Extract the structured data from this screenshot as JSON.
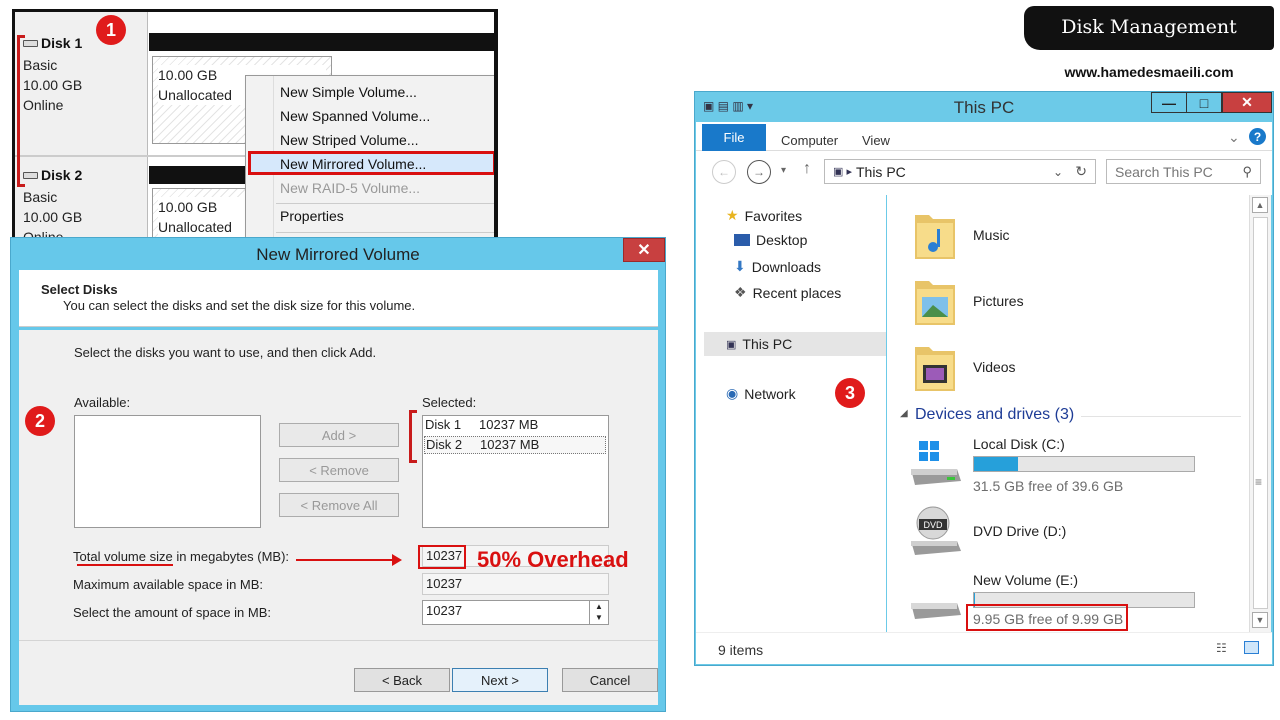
{
  "banner": {
    "title": "Disk Management",
    "url": "www.hamedesmaeili.com"
  },
  "badges": {
    "one": "1",
    "two": "2",
    "three": "3"
  },
  "disk_mgmt": {
    "disks": [
      {
        "name": "Disk 1",
        "type": "Basic",
        "size": "10.00 GB",
        "status": "Online",
        "space_size": "10.00 GB",
        "space_status": "Unallocated"
      },
      {
        "name": "Disk 2",
        "type": "Basic",
        "size": "10.00 GB",
        "status": "Online",
        "space_size": "10.00 GB",
        "space_status": "Unallocated"
      }
    ],
    "menu": [
      {
        "label": "New Simple Volume...",
        "enabled": true
      },
      {
        "label": "New Spanned Volume...",
        "enabled": true
      },
      {
        "label": "New Striped Volume...",
        "enabled": true
      },
      {
        "label": "New Mirrored Volume...",
        "enabled": true,
        "highlighted": true
      },
      {
        "label": "New RAID-5 Volume...",
        "enabled": false
      },
      {
        "label": "Properties",
        "enabled": true
      }
    ]
  },
  "dialog": {
    "title": "New Mirrored Volume",
    "close": "✕",
    "header_title": "Select Disks",
    "header_desc": "You can select the disks and set the disk size for this volume.",
    "instruction": "Select the disks you want to use, and then click Add.",
    "available_label": "Available:",
    "selected_label": "Selected:",
    "selected": [
      {
        "disk": "Disk 1",
        "size": "10237 MB"
      },
      {
        "disk": "Disk 2",
        "size": "10237 MB"
      }
    ],
    "add_button": "Add >",
    "remove_button": "< Remove",
    "remove_all_button": "< Remove All",
    "total_label": "Total volume size in megabytes (MB):",
    "total_value": "10237",
    "max_label": "Maximum available space in MB:",
    "max_value": "10237",
    "amount_label": "Select the amount of space in MB:",
    "amount_value": "10237",
    "back_button": "< Back",
    "next_button": "Next >",
    "cancel_button": "Cancel",
    "overhead_note": "50% Overhead"
  },
  "explorer": {
    "title": "This PC",
    "tabs": {
      "file": "File",
      "computer": "Computer",
      "view": "View"
    },
    "address": "This PC",
    "search_placeholder": "Search This PC",
    "nav": {
      "favorites": "Favorites",
      "desktop": "Desktop",
      "downloads": "Downloads",
      "recent": "Recent places",
      "this_pc": "This PC",
      "network": "Network"
    },
    "folders": [
      "Music",
      "Pictures",
      "Videos"
    ],
    "section": "Devices and drives (3)",
    "drives": [
      {
        "name": "Local Disk (C:)",
        "free": "31.5 GB free of 39.6 GB",
        "used_fraction": 0.2
      },
      {
        "name": "DVD Drive (D:)"
      },
      {
        "name": "New Volume (E:)",
        "free": "9.95 GB free of 9.99 GB",
        "used_fraction": 0.004
      }
    ],
    "status": "9 items"
  },
  "colors": {
    "accent_red": "#d91010",
    "dialog_frame": "#66c8ea",
    "file_tab": "#1979ca",
    "drive_bar": "#26a0da"
  }
}
